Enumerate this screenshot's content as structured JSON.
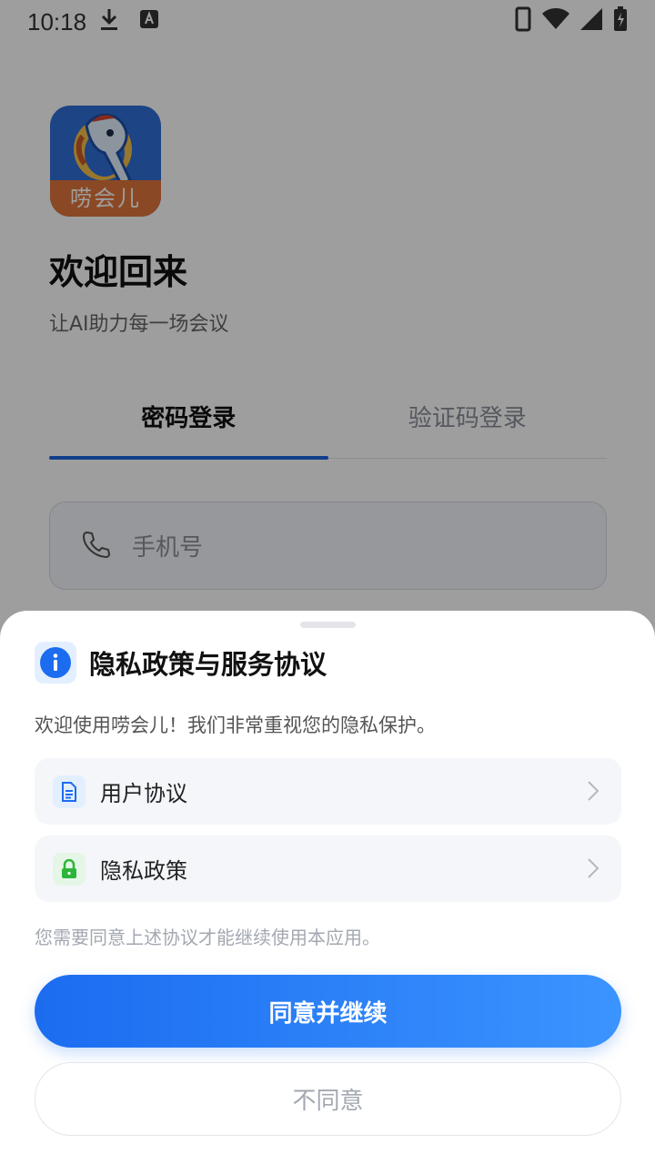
{
  "status_bar": {
    "time": "10:18",
    "icons": [
      "download-icon",
      "keyboard-a-icon",
      "phone-icon",
      "wifi-icon",
      "signal-icon",
      "battery-charging-icon"
    ]
  },
  "login": {
    "logo_text": "唠会儿",
    "title": "欢迎回来",
    "subtitle": "让AI助力每一场会议",
    "tabs": [
      {
        "label": "密码登录",
        "active": true
      },
      {
        "label": "验证码登录",
        "active": false
      }
    ],
    "phone_placeholder": "手机号"
  },
  "sheet": {
    "title": "隐私政策与服务协议",
    "description": "欢迎使用唠会儿！我们非常重视您的隐私保护。",
    "items": [
      {
        "label": "用户协议",
        "icon": "document-icon"
      },
      {
        "label": "隐私政策",
        "icon": "lock-icon"
      }
    ],
    "note": "您需要同意上述协议才能继续使用本应用。",
    "agree_label": "同意并继续",
    "disagree_label": "不同意"
  },
  "colors": {
    "accent": "#1c6cf0",
    "accent_light": "#3b94ff",
    "lock_green": "#2db53a",
    "overlay": "rgba(0,0,0,0.38)"
  }
}
